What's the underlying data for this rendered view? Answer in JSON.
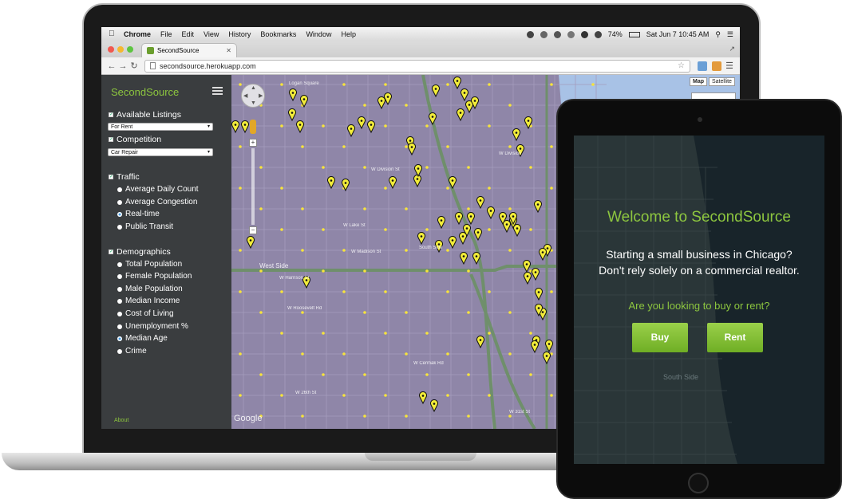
{
  "menubar": {
    "app": "Chrome",
    "items": [
      "File",
      "Edit",
      "View",
      "History",
      "Bookmarks",
      "Window",
      "Help"
    ],
    "battery": "74%",
    "clock": "Sat Jun 7  10:45 AM"
  },
  "browser": {
    "tab_title": "SecondSource",
    "url": "secondsource.herokuapp.com"
  },
  "sidebar": {
    "brand": "SecondSource",
    "listings": {
      "label": "Available Listings",
      "selected": "For Rent"
    },
    "competition": {
      "label": "Competition",
      "selected": "Car Repair"
    },
    "traffic": {
      "label": "Traffic",
      "options": [
        "Average Daily Count",
        "Average Congestion",
        "Real-time",
        "Public Transit"
      ],
      "selected": "Real-time"
    },
    "demographics": {
      "label": "Demographics",
      "options": [
        "Total Population",
        "Female Population",
        "Male Population",
        "Median Income",
        "Cost of Living",
        "Unemployment %",
        "Median Age",
        "Crime"
      ],
      "selected": "Median Age"
    },
    "about": "About"
  },
  "map": {
    "type_buttons": [
      "Map",
      "Satellite"
    ],
    "active_type": "Map",
    "provider": "Google",
    "labels": [
      "West Side",
      "W Harrison St",
      "W Roosevelt Rd",
      "W Cermak Rd",
      "W 26th St",
      "W Division St",
      "W Madison St",
      "W Lake St",
      "Logan Square",
      "South Side",
      "W 31st St",
      "W Division"
    ]
  },
  "tablet": {
    "welcome": "Welcome to SecondSource",
    "pitch_line1": "Starting a small business in Chicago?",
    "pitch_line2": "Don't rely solely on a commercial realtor.",
    "question": "Are you looking to buy or rent?",
    "buy": "Buy",
    "rent": "Rent",
    "map_label": "South Side"
  },
  "colors": {
    "brand_green": "#8dc63f",
    "sidebar_bg": "#3a3d3f",
    "map_purple": "#8f86a8"
  }
}
